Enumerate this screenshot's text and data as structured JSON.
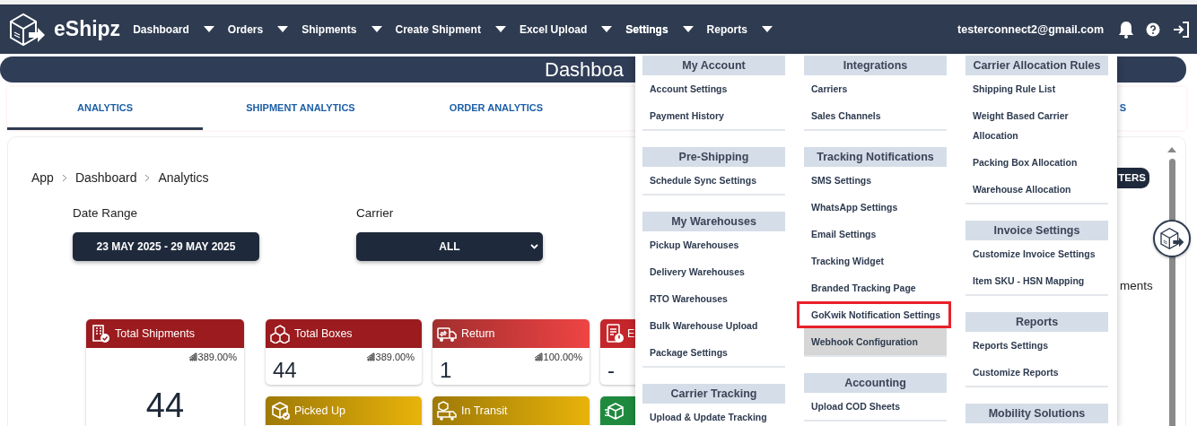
{
  "navbar": {
    "logo": "eShipz",
    "items": [
      {
        "label": "Dashboard",
        "expanded": false
      },
      {
        "label": "Orders",
        "expanded": false
      },
      {
        "label": "Shipments",
        "expanded": false
      },
      {
        "label": "Create Shipment",
        "expanded": false
      },
      {
        "label": "Excel Upload",
        "expanded": false
      },
      {
        "label": "Settings",
        "expanded": true
      },
      {
        "label": "Reports",
        "expanded": false
      }
    ],
    "user_email": "testerconnect2@gmail.com"
  },
  "page_title": "Dashboa",
  "tabs": [
    {
      "label": "ANALYTICS",
      "selected": true
    },
    {
      "label": "SHIPMENT ANALYTICS",
      "selected": false
    },
    {
      "label": "ORDER ANALYTICS",
      "selected": false
    },
    {
      "label": "S",
      "selected": false
    }
  ],
  "content": {
    "breadcrumbs": [
      "App",
      "Dashboard",
      "Analytics"
    ],
    "filter_button": "TERS",
    "side_text": "ments",
    "date_range": {
      "label": "Date Range",
      "value": "23 MAY 2025 - 29 MAY 2025"
    },
    "carrier": {
      "label": "Carrier",
      "value": "ALL"
    },
    "cards": [
      {
        "label": "Total Shipments",
        "value": "44",
        "trend": "389.00%",
        "color": "#9b1b1e",
        "kind": "tall"
      },
      {
        "label": "Total Boxes",
        "value": "44",
        "trend": "389.00%",
        "color": "#9b1b1e",
        "kind": "solid"
      },
      {
        "label": "Return",
        "value": "1",
        "trend": "100.00%",
        "color": "#ef4444",
        "kind": "gradient"
      },
      {
        "label": "E",
        "value": "-",
        "color": "#c4262b",
        "kind": "solid"
      },
      {
        "label": "Picked Up",
        "color": "#e8b30a",
        "kind": "gradient"
      },
      {
        "label": "In Transit",
        "color": "#e8b30a",
        "kind": "gradient"
      },
      {
        "color": "#1f8a3e",
        "kind": "solid"
      }
    ]
  },
  "settings_menu": {
    "columns": [
      {
        "sections": [
          {
            "title": "My Account",
            "items": [
              {
                "label": "Account Settings"
              },
              {
                "label": "Payment History"
              }
            ]
          },
          {
            "title": "Pre-Shipping",
            "items": [
              {
                "label": "Schedule Sync Settings"
              }
            ]
          },
          {
            "title": "My Warehouses",
            "items": [
              {
                "label": "Pickup Warehouses"
              },
              {
                "label": "Delivery Warehouses"
              },
              {
                "label": "RTO Warehouses"
              },
              {
                "label": "Bulk Warehouse Upload"
              },
              {
                "label": "Package Settings"
              }
            ]
          },
          {
            "title": "Carrier Tracking",
            "items": [
              {
                "label": "Upload & Update Tracking"
              }
            ]
          }
        ]
      },
      {
        "sections": [
          {
            "title": "Integrations",
            "items": [
              {
                "label": "Carriers"
              },
              {
                "label": "Sales Channels"
              }
            ]
          },
          {
            "title": "Tracking Notifications",
            "items": [
              {
                "label": "SMS Settings",
                "outlined": false,
                "hovered": false
              },
              {
                "label": "WhatsApp Settings",
                "outlined": false,
                "hovered": false
              },
              {
                "label": "Email Settings",
                "outlined": false,
                "hovered": false
              },
              {
                "label": "Tracking Widget",
                "outlined": false,
                "hovered": false
              },
              {
                "label": "Branded Tracking Page",
                "outlined": false,
                "hovered": false
              },
              {
                "label": "GoKwik Notification Settings",
                "outlined": true,
                "hovered": false
              },
              {
                "label": "Webhook Configuration",
                "outlined": false,
                "hovered": true
              }
            ]
          },
          {
            "title": "Accounting",
            "items": [
              {
                "label": "Upload COD Sheets"
              }
            ]
          }
        ]
      },
      {
        "sections": [
          {
            "title": "Carrier Allocation Rules",
            "items": [
              {
                "label": "Shipping Rule List"
              },
              {
                "label": "Weight Based Carrier Allocation"
              },
              {
                "label": "Packing Box Allocation"
              },
              {
                "label": "Warehouse Allocation"
              }
            ]
          },
          {
            "title": "Invoice Settings",
            "items": [
              {
                "label": "Customize Invoice Settings"
              },
              {
                "label": "Item SKU - HSN Mapping"
              }
            ]
          },
          {
            "title": "Reports",
            "items": [
              {
                "label": "Reports Settings"
              },
              {
                "label": "Customize Reports"
              }
            ]
          },
          {
            "title": "Mobility Solutions"
          }
        ]
      }
    ]
  }
}
